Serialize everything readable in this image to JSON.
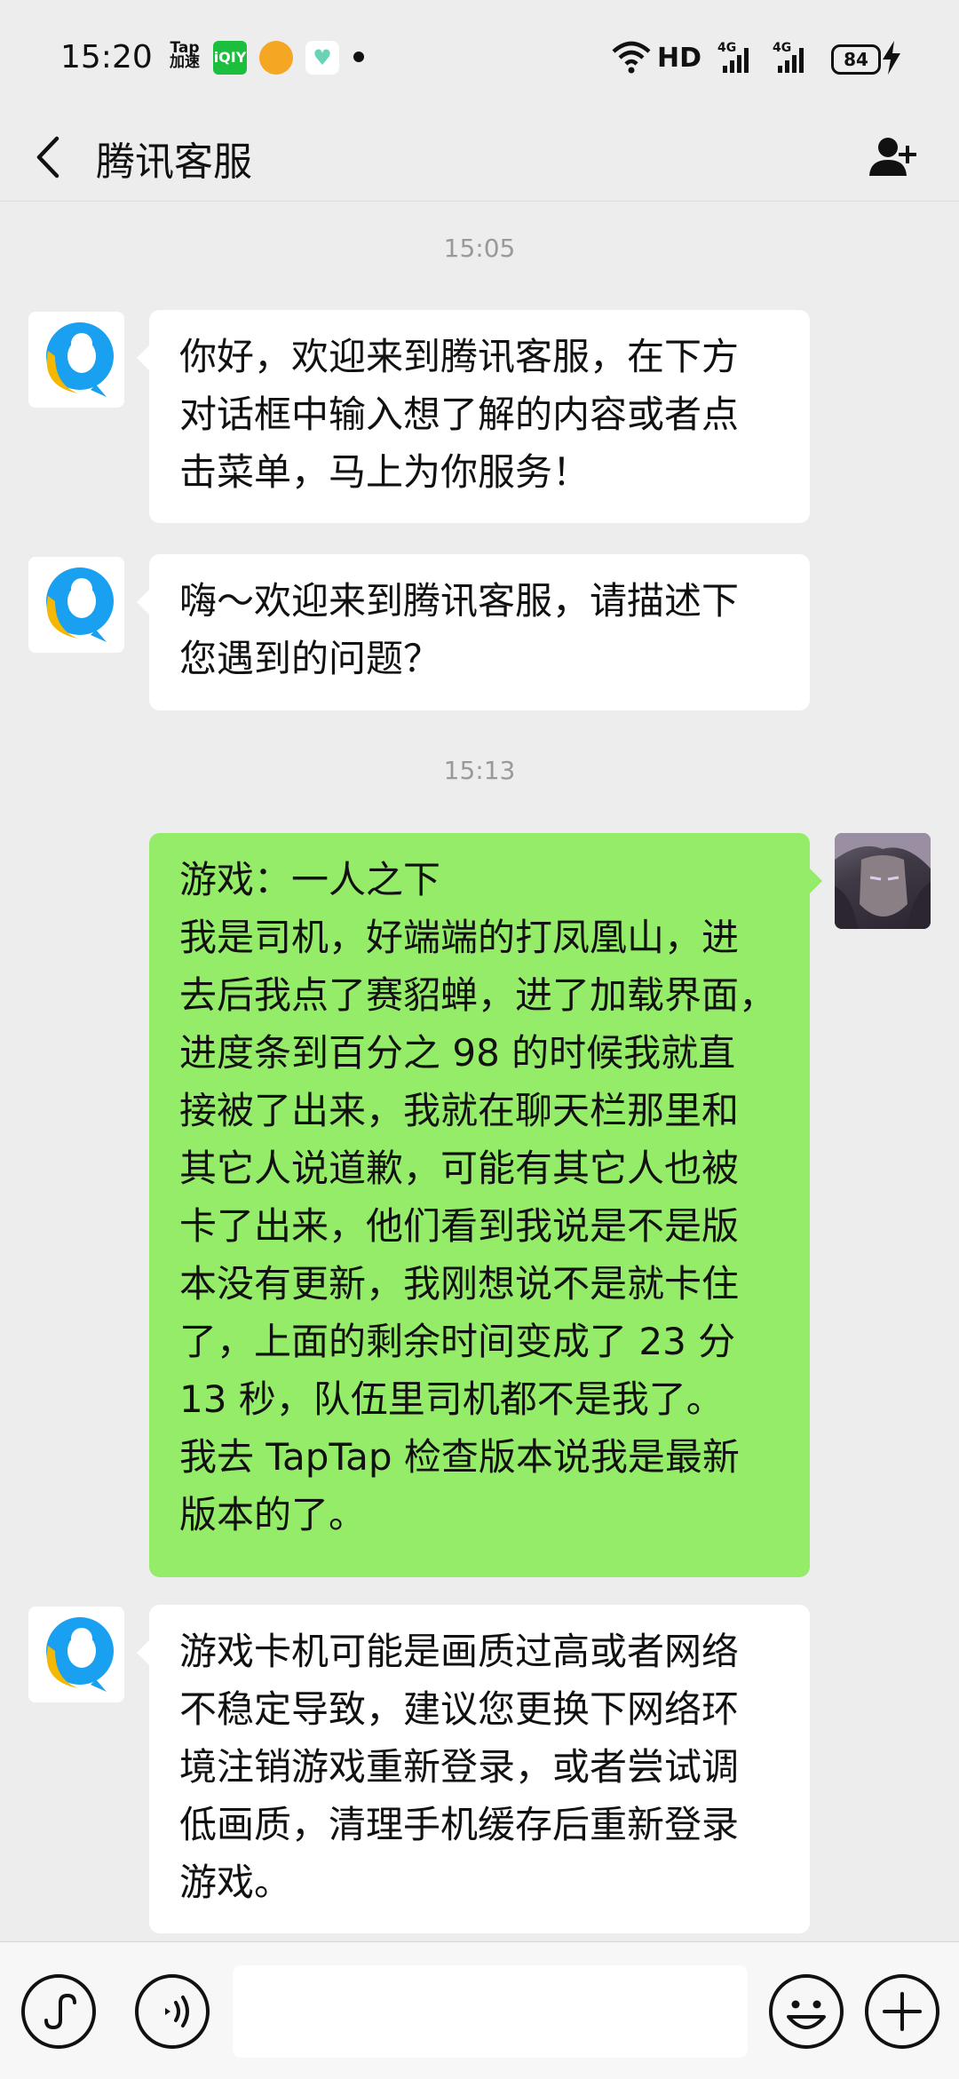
{
  "status_bar": {
    "time": "15:20",
    "tap_label": "Tap\n加速",
    "iqiyi_label": "iQIY",
    "network_label": "HD",
    "battery": "84",
    "icons": [
      "tap-accelerate-icon",
      "iqiyi-icon",
      "fox-app-icon",
      "heart-app-icon",
      "wifi-icon",
      "4g-signal-icon",
      "battery-icon",
      "charging-icon"
    ]
  },
  "header": {
    "title": "腾讯客服",
    "back_icon": "back-chevron-icon",
    "action_icon": "add-user-icon"
  },
  "chat": {
    "timestamps": [
      "15:05",
      "15:13"
    ],
    "messages": [
      {
        "from": "service",
        "text": "你好，欢迎来到腾讯客服，在下方\n对话框中输入想了解的内容或者点\n击菜单，马上为你服务！"
      },
      {
        "from": "service",
        "text": "嗨～欢迎来到腾讯客服，请描述下\n您遇到的问题？"
      },
      {
        "from": "user",
        "text": "游戏：一人之下\n我是司机，好端端的打凤凰山，进\n去后我点了赛貂蝉，进了加载界面，\n进度条到百分之 98 的时候我就直\n接被了出来，我就在聊天栏那里和\n其它人说道歉，可能有其它人也被\n卡了出来，他们看到我说是不是版\n本没有更新，我刚想说不是就卡住\n了，上面的剩余时间变成了 23 分\n13 秒，队伍里司机都不是我了。\n我去 TapTap 检查版本说我是最新\n版本的了。"
      },
      {
        "from": "service",
        "text": "游戏卡机可能是画质过高或者网络\n不稳定导致，建议您更换下网络环\n境注销游戏重新登录，或者尝试调\n低画质，清理手机缓存后重新登录\n游戏。"
      }
    ]
  },
  "input_bar": {
    "value": "",
    "placeholder": "",
    "icons": [
      "mini-program-icon",
      "voice-icon",
      "emoji-icon",
      "plus-icon"
    ]
  },
  "colors": {
    "background": "#ededed",
    "user_bubble": "#95ec69",
    "service_bubble": "#ffffff",
    "qq_blue": "#1aa0f0",
    "qq_yellow": "#f5b800"
  }
}
